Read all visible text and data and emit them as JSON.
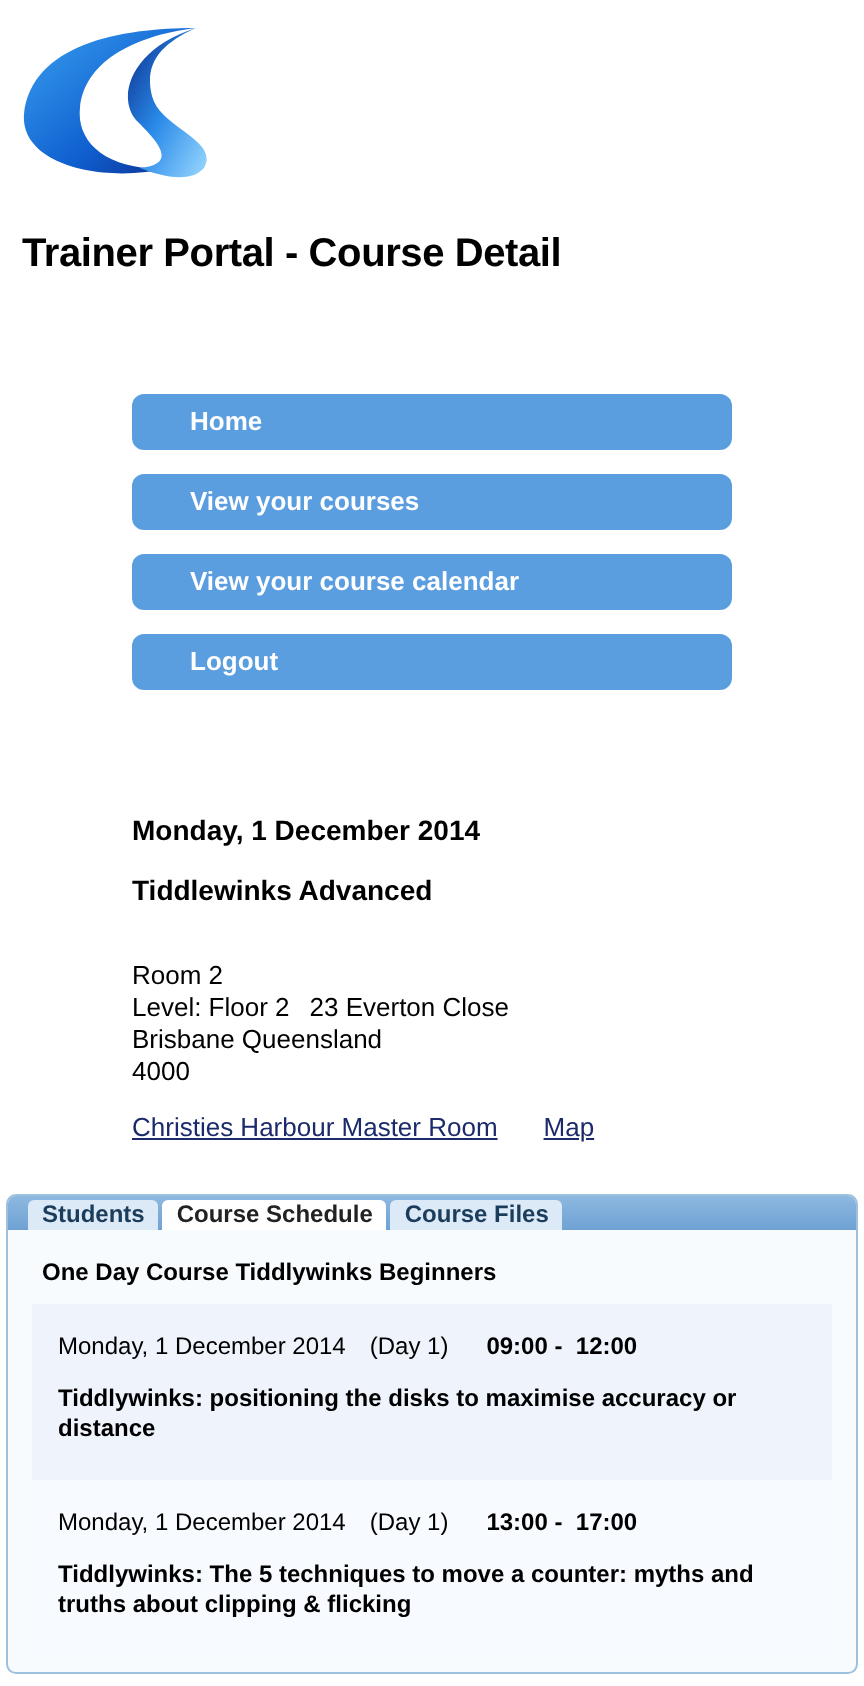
{
  "header": {
    "title": "Trainer Portal - Course Detail"
  },
  "nav": [
    {
      "label": "Home"
    },
    {
      "label": "View your courses"
    },
    {
      "label": "View your course calendar"
    },
    {
      "label": "Logout"
    }
  ],
  "course": {
    "date": "Monday, 1 December 2014",
    "name": "Tiddlewinks Advanced",
    "address": [
      [
        "Room 2"
      ],
      [
        "Level: Floor 2",
        "23 Everton Close"
      ],
      [
        "Brisbane Queensland"
      ],
      [
        "4000"
      ]
    ],
    "links": [
      {
        "label": "Christies Harbour Master Room"
      },
      {
        "label": "Map"
      }
    ]
  },
  "tabs": [
    {
      "label": "Students",
      "selected": false
    },
    {
      "label": "Course Schedule",
      "selected": true
    },
    {
      "label": "Course Files",
      "selected": false
    }
  ],
  "schedule": {
    "heading": "One Day Course Tiddlywinks Beginners",
    "sessions": [
      {
        "date": "Monday, 1 December 2014",
        "day": "(Day 1)",
        "time": "09:00 -  12:00",
        "title": "Tiddlywinks: positioning the disks to maximise accuracy or distance"
      },
      {
        "date": "Monday, 1 December 2014",
        "day": "(Day 1)",
        "time": "13:00 -  17:00",
        "title": "Tiddlywinks: The 5 techniques to move a counter: myths and truths about clipping & flicking"
      }
    ]
  }
}
